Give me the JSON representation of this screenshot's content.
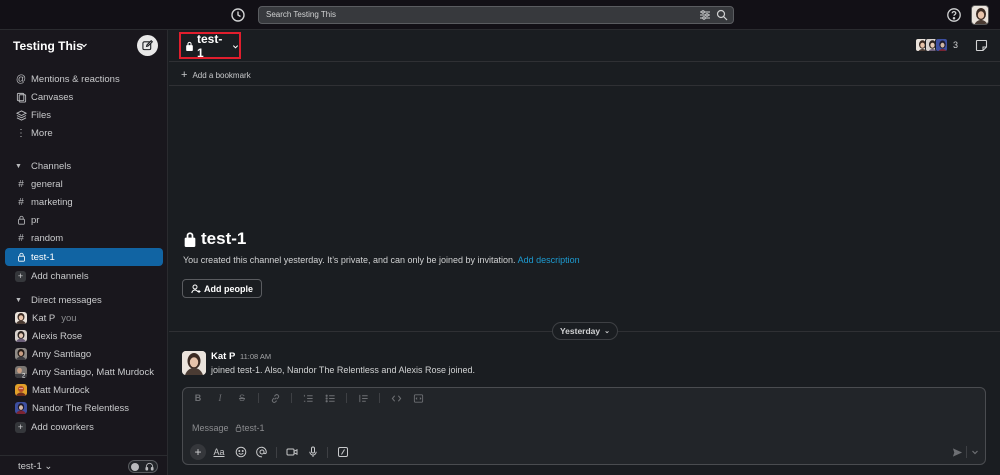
{
  "topbar": {
    "search_placeholder": "Search Testing This"
  },
  "sidebar": {
    "workspace_name": "Testing This",
    "top_items": [
      {
        "label": "Mentions & reactions",
        "icon": "at-icon"
      },
      {
        "label": "Canvases",
        "icon": "canvases-icon"
      },
      {
        "label": "Files",
        "icon": "files-icon"
      },
      {
        "label": "More",
        "icon": "more-icon"
      }
    ],
    "channels_label": "Channels",
    "channels": [
      {
        "name": "general",
        "icon": "hash-icon",
        "active": false
      },
      {
        "name": "marketing",
        "icon": "hash-icon",
        "active": false
      },
      {
        "name": "pr",
        "icon": "lock-icon",
        "active": false
      },
      {
        "name": "random",
        "icon": "hash-icon",
        "active": false
      },
      {
        "name": "test-1",
        "icon": "lock-icon",
        "active": true
      }
    ],
    "add_channels_label": "Add channels",
    "dm_label": "Direct messages",
    "dms": [
      {
        "name": "Kat P",
        "suffix": "you"
      },
      {
        "name": "Alexis Rose"
      },
      {
        "name": "Amy Santiago"
      },
      {
        "name": "Amy Santiago, Matt Murdock",
        "badge": "2"
      },
      {
        "name": "Matt Murdock"
      },
      {
        "name": "Nandor The Relentless"
      }
    ],
    "add_coworkers_label": "Add coworkers",
    "footer_workspace": "test-1"
  },
  "channel": {
    "name": "test-1",
    "member_count": "3",
    "bookmark_label": "Add a bookmark",
    "intro_title": "test-1",
    "intro_text": "You created this channel yesterday. It’s private, and can only be joined by invitation.",
    "intro_link": "Add description",
    "add_people_label": "Add people",
    "date_divider": "Yesterday"
  },
  "messages": [
    {
      "author": "Kat P",
      "time": "11:08 AM",
      "text": "joined test-1. Also, Nandor The Relentless and Alexis Rose joined."
    }
  ],
  "composer": {
    "placeholder": "Message",
    "placeholder_channel": "test-1",
    "format_label": "Aa"
  },
  "colors": {
    "accent_active": "#1164a3",
    "link": "#1d9bd1",
    "highlight_box": "#e01e2d"
  }
}
